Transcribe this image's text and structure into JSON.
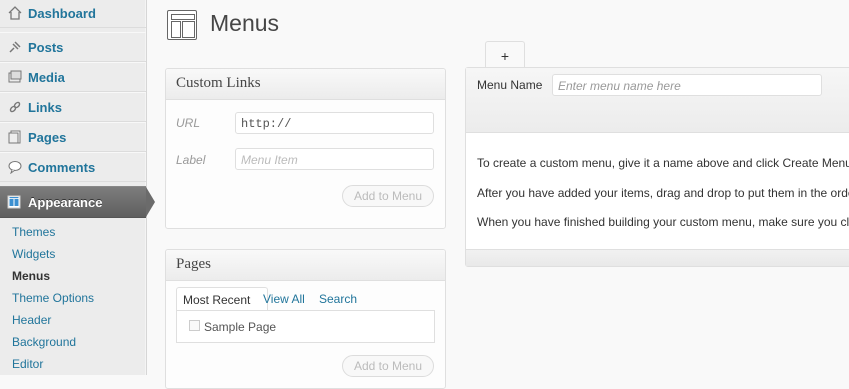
{
  "sidebar": {
    "items": [
      {
        "label": "Dashboard",
        "icon": "home-icon"
      },
      {
        "label": "Posts",
        "icon": "pin-icon"
      },
      {
        "label": "Media",
        "icon": "media-icon"
      },
      {
        "label": "Links",
        "icon": "link-icon"
      },
      {
        "label": "Pages",
        "icon": "pages-icon"
      },
      {
        "label": "Comments",
        "icon": "comment-icon"
      }
    ],
    "active": {
      "label": "Appearance",
      "icon": "appearance-icon"
    },
    "submenu": [
      "Themes",
      "Widgets",
      "Menus",
      "Theme Options",
      "Header",
      "Background",
      "Editor"
    ],
    "current_submenu": "Menus"
  },
  "page": {
    "title": "Menus"
  },
  "custom_links": {
    "title": "Custom Links",
    "url_label": "URL",
    "url_value": "http://",
    "label_label": "Label",
    "label_placeholder": "Menu Item",
    "add_button": "Add to Menu"
  },
  "pages_box": {
    "title": "Pages",
    "tabs": [
      "Most Recent",
      "View All",
      "Search"
    ],
    "items": [
      "Sample Page"
    ],
    "add_button": "Add to Menu"
  },
  "menu_editor": {
    "add_tab": "+",
    "name_label": "Menu Name",
    "name_placeholder": "Enter menu name here",
    "instructions": [
      "To create a custom menu, give it a name above and click Create Menu",
      "After you have added your items, drag and drop to put them in the orde",
      "When you have finished building your custom menu, make sure you cli"
    ]
  }
}
